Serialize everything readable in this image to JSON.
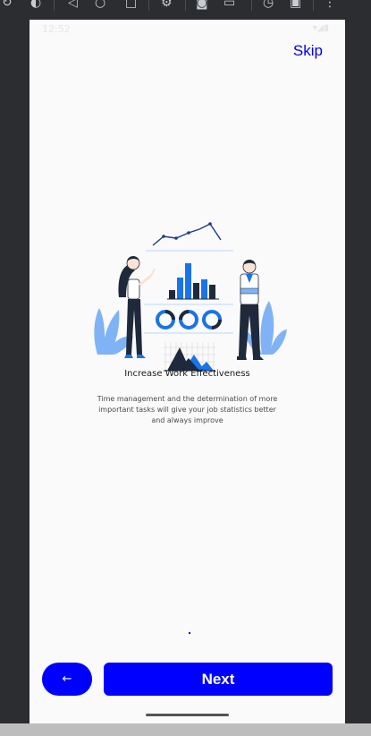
{
  "toolbar": {
    "icons": [
      "rotate-icon",
      "snapshot-icon",
      "back-triangle-icon",
      "home-circle-icon",
      "overview-square-icon",
      "settings-icon",
      "camera-icon",
      "video-icon",
      "clock-icon",
      "phone-link-icon",
      "more-vert-icon"
    ]
  },
  "status_bar": {
    "time": "12:52",
    "icons": "▾◢▮"
  },
  "onboarding": {
    "skip_label": "Skip",
    "title": "Increase Work Effectiveness",
    "description": "Time management and the determination of more important tasks will give your job statistics better and always improve",
    "page_indicator": "."
  },
  "buttons": {
    "back_icon": "←",
    "next_label": "Next"
  },
  "colors": {
    "accent": "#0000ff",
    "link": "#0000ee",
    "illustration_blue": "#1a73e8",
    "illustration_light_blue": "#7fb3f5",
    "background": "#fafafa"
  }
}
